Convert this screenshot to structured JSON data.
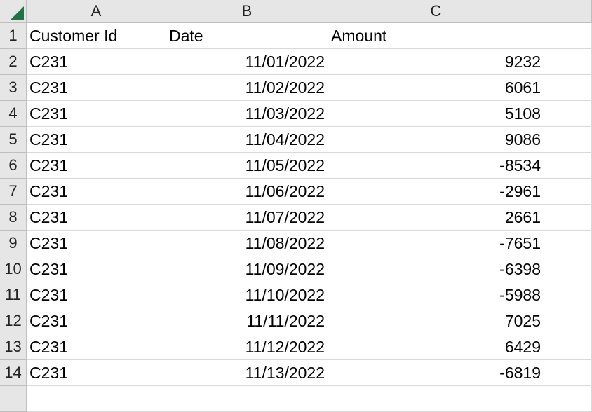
{
  "columns": [
    "A",
    "B",
    "C"
  ],
  "rows": [
    "1",
    "2",
    "3",
    "4",
    "5",
    "6",
    "7",
    "8",
    "9",
    "10",
    "11",
    "12",
    "13",
    "14"
  ],
  "header": {
    "customer_id": "Customer Id",
    "date": "Date",
    "amount": "Amount"
  },
  "data": [
    {
      "customer": "C231",
      "date": "11/01/2022",
      "amount": "9232"
    },
    {
      "customer": "C231",
      "date": "11/02/2022",
      "amount": "6061"
    },
    {
      "customer": "C231",
      "date": "11/03/2022",
      "amount": "5108"
    },
    {
      "customer": "C231",
      "date": "11/04/2022",
      "amount": "9086"
    },
    {
      "customer": "C231",
      "date": "11/05/2022",
      "amount": "-8534"
    },
    {
      "customer": "C231",
      "date": "11/06/2022",
      "amount": "-2961"
    },
    {
      "customer": "C231",
      "date": "11/07/2022",
      "amount": "2661"
    },
    {
      "customer": "C231",
      "date": "11/08/2022",
      "amount": "-7651"
    },
    {
      "customer": "C231",
      "date": "11/09/2022",
      "amount": "-6398"
    },
    {
      "customer": "C231",
      "date": "11/10/2022",
      "amount": "-5988"
    },
    {
      "customer": "C231",
      "date": "11/11/2022",
      "amount": "7025"
    },
    {
      "customer": "C231",
      "date": "11/12/2022",
      "amount": "6429"
    },
    {
      "customer": "C231",
      "date": "11/13/2022",
      "amount": "-6819"
    }
  ],
  "colors": {
    "header_bg": "#e6e6e6",
    "corner_triangle": "#217346",
    "gridline": "#d9d9d9"
  }
}
